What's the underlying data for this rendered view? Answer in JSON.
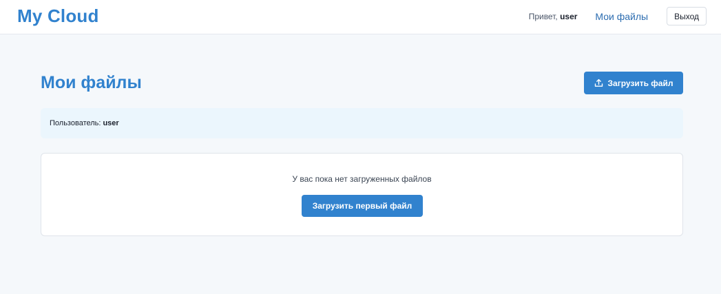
{
  "header": {
    "logo": "My Cloud",
    "greeting_prefix": "Привет,",
    "username": "user",
    "nav_my_files": "Мои файлы",
    "logout_label": "Выход"
  },
  "main": {
    "title": "Мои файлы",
    "upload_label": "Загрузить файл",
    "upload_icon": "upload-icon",
    "user_label": "Пользователь:",
    "user_value": "user"
  },
  "files": {
    "empty_message": "У вас пока нет загруженных файлов",
    "first_upload_label": "Загрузить первый файл"
  },
  "colors": {
    "accent": "#3182ce",
    "nav_link": "#2b6cb0",
    "page_bg": "#f5f8fb",
    "info_panel_bg": "#ebf6fd"
  }
}
